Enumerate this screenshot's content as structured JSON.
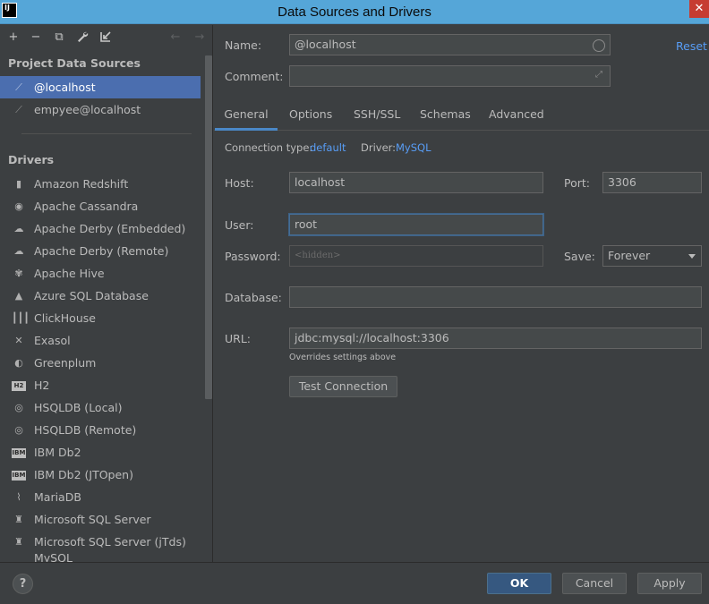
{
  "window": {
    "title": "Data Sources and Drivers",
    "app_icon_text": "IJ",
    "close_glyph": "✕"
  },
  "toolbar": {
    "add": "+",
    "remove": "−",
    "duplicate": "⧉",
    "settings": "🔧",
    "import": "⬋",
    "back": "←",
    "forward": "→"
  },
  "project_sources": {
    "heading": "Project Data Sources",
    "items": [
      {
        "label": "@localhost",
        "selected": true
      },
      {
        "label": "empyee@localhost",
        "selected": false
      }
    ]
  },
  "drivers": {
    "heading": "Drivers",
    "items": [
      {
        "label": "Amazon Redshift",
        "icon": "redshift-icon"
      },
      {
        "label": "Apache Cassandra",
        "icon": "cassandra-icon"
      },
      {
        "label": "Apache Derby (Embedded)",
        "icon": "derby-icon"
      },
      {
        "label": "Apache Derby (Remote)",
        "icon": "derby-icon"
      },
      {
        "label": "Apache Hive",
        "icon": "hive-icon"
      },
      {
        "label": "Azure SQL Database",
        "icon": "azure-icon"
      },
      {
        "label": "ClickHouse",
        "icon": "clickhouse-icon"
      },
      {
        "label": "Exasol",
        "icon": "exasol-icon"
      },
      {
        "label": "Greenplum",
        "icon": "greenplum-icon"
      },
      {
        "label": "H2",
        "icon": "h2-icon"
      },
      {
        "label": "HSQLDB (Local)",
        "icon": "hsqldb-icon"
      },
      {
        "label": "HSQLDB (Remote)",
        "icon": "hsqldb-icon"
      },
      {
        "label": "IBM Db2",
        "icon": "ibm-db2-icon"
      },
      {
        "label": "IBM Db2 (JTOpen)",
        "icon": "ibm-db2-icon"
      },
      {
        "label": "MariaDB",
        "icon": "mariadb-icon"
      },
      {
        "label": "Microsoft SQL Server",
        "icon": "sqlserver-icon"
      },
      {
        "label": "Microsoft SQL Server (jTds)",
        "icon": "sqlserver-icon"
      },
      {
        "label": "MySQL",
        "icon": "mysql-icon"
      }
    ]
  },
  "form": {
    "name_label": "Name:",
    "name_value": "@localhost",
    "comment_label": "Comment:",
    "comment_value": "",
    "reset_label": "Reset",
    "tabs": [
      "General",
      "Options",
      "SSH/SSL",
      "Schemas",
      "Advanced"
    ],
    "active_tab": "General",
    "connection_type_label": "Connection type:",
    "connection_type_value": "default",
    "driver_label": "Driver:",
    "driver_value": "MySQL",
    "host_label": "Host:",
    "host_value": "localhost",
    "port_label": "Port:",
    "port_value": "3306",
    "user_label": "User:",
    "user_value": "root",
    "password_label": "Password:",
    "password_placeholder": "<hidden>",
    "save_label": "Save:",
    "save_value": "Forever",
    "database_label": "Database:",
    "database_value": "",
    "url_label": "URL:",
    "url_value": "jdbc:mysql://localhost:3306",
    "url_note": "Overrides settings above",
    "test_connection_label": "Test Connection"
  },
  "footer": {
    "help": "?",
    "ok": "OK",
    "cancel": "Cancel",
    "apply": "Apply"
  },
  "colors": {
    "accent": "#4b6eaf",
    "link": "#589df6",
    "primary_button": "#365880",
    "titlebar": "#55a6d8"
  }
}
